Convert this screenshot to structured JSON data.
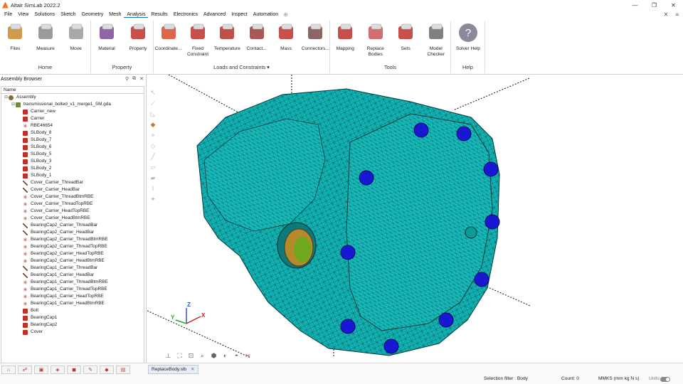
{
  "app": {
    "title": "Altair SimLab 2022.2"
  },
  "window_controls": {
    "minimize": "—",
    "restore": "❐",
    "close": "✕"
  },
  "menu": {
    "items": [
      "File",
      "View",
      "Solutions",
      "Sketch",
      "Geometry",
      "Mesh",
      "Analysis",
      "Results",
      "Electronics",
      "Advanced",
      "Inspect",
      "Automation"
    ],
    "active": "Analysis",
    "extra": "⊕",
    "right_icons": [
      "✕",
      "≡"
    ]
  },
  "ribbon": {
    "groups": [
      {
        "label": "Home",
        "tools": [
          "Files",
          "Measure",
          "Move"
        ]
      },
      {
        "label": "Property",
        "tools": [
          "Material",
          "Property"
        ]
      },
      {
        "label": "Loads and Constraints ▾",
        "tools": [
          "Coordinate...",
          "Fixed Constraint",
          "Temperature",
          "Contact...",
          "Mass",
          "Connectors..."
        ]
      },
      {
        "label": "Tools",
        "tools": [
          "Mapping",
          "Replace Bodies",
          "Sets",
          "Model Checker"
        ]
      },
      {
        "label": "Help",
        "tools": [
          "Solver Help"
        ]
      }
    ]
  },
  "browser": {
    "title": "Assembly Browser",
    "controls": [
      "⚲",
      "⧉",
      "✕"
    ],
    "column": "Name",
    "items": [
      {
        "label": "Assembly",
        "type": "asm",
        "level": 0,
        "exp": "⊟"
      },
      {
        "label": "transmissional_bolted_v1_merge1_SM.gda",
        "type": "file",
        "level": 1,
        "exp": "⊟"
      },
      {
        "label": "Carrier_new",
        "type": "cube",
        "level": 2
      },
      {
        "label": "Carrier",
        "type": "cube",
        "level": 2
      },
      {
        "label": "RBE46654",
        "type": "rbe",
        "level": 2
      },
      {
        "label": "SLBody_8",
        "type": "cube",
        "level": 2
      },
      {
        "label": "SLBody_7",
        "type": "cube",
        "level": 2
      },
      {
        "label": "SLBody_6",
        "type": "cube",
        "level": 2
      },
      {
        "label": "SLBody_5",
        "type": "cube",
        "level": 2
      },
      {
        "label": "SLBody_3",
        "type": "cube",
        "level": 2
      },
      {
        "label": "SLBody_2",
        "type": "cube",
        "level": 2
      },
      {
        "label": "SLBody_1",
        "type": "cube",
        "level": 2
      },
      {
        "label": "Cover_Carrier_ThreadBar",
        "type": "bar",
        "level": 2
      },
      {
        "label": "Cover_Carrier_HeadBar",
        "type": "bar",
        "level": 2
      },
      {
        "label": "Cover_Carrier_ThreadBtmRBE",
        "type": "rbe",
        "level": 2
      },
      {
        "label": "Cover_Carrier_ThreadTopRBE",
        "type": "rbe",
        "level": 2
      },
      {
        "label": "Cover_Carrier_HeadTopRBE",
        "type": "rbe",
        "level": 2
      },
      {
        "label": "Cover_Carrier_HeadBtmRBE",
        "type": "rbe",
        "level": 2
      },
      {
        "label": "BearingCap2_Carrier_ThreadBar",
        "type": "bar",
        "level": 2
      },
      {
        "label": "BearingCap2_Carrier_HeadBar",
        "type": "bar",
        "level": 2
      },
      {
        "label": "BearingCap2_Carrier_ThreadBtmRBE",
        "type": "rbe",
        "level": 2
      },
      {
        "label": "BearingCap2_Carrier_ThreadTopRBE",
        "type": "rbe",
        "level": 2
      },
      {
        "label": "BearingCap2_Carrier_HeadTopRBE",
        "type": "rbe",
        "level": 2
      },
      {
        "label": "BearingCap2_Carrier_HeadBtmRBE",
        "type": "rbe",
        "level": 2
      },
      {
        "label": "BearingCap1_Carrier_ThreadBar",
        "type": "bar",
        "level": 2
      },
      {
        "label": "BearingCap1_Carrier_HeadBar",
        "type": "bar",
        "level": 2
      },
      {
        "label": "BearingCap1_Carrier_ThreadBtmRBE",
        "type": "rbe",
        "level": 2
      },
      {
        "label": "BearingCap1_Carrier_ThreadTopRBE",
        "type": "rbe",
        "level": 2
      },
      {
        "label": "BearingCap1_Carrier_HeadTopRBE",
        "type": "rbe",
        "level": 2
      },
      {
        "label": "BearingCap1_Carrier_HeadBtmRBE",
        "type": "rbe",
        "level": 2
      },
      {
        "label": "Bolt",
        "type": "cube",
        "level": 2
      },
      {
        "label": "BearingCap1",
        "type": "cube",
        "level": 2
      },
      {
        "label": "BearingCap2",
        "type": "cube",
        "level": 2
      },
      {
        "label": "Cover",
        "type": "cube",
        "level": 2
      }
    ]
  },
  "bottom": {
    "tab": "ReplaceBody.slb",
    "tab_close": "✕",
    "selection_filter": "Selection filter : Body",
    "count": "Count: 0",
    "units": "MMKS (mm kg N s)",
    "units_label": "Units"
  },
  "axes": {
    "x": "X",
    "y": "Y",
    "z": "Z"
  },
  "colors": {
    "mesh": "#14b7b7",
    "bolt": "#1a1ad6",
    "active": "#1a6fc7"
  }
}
